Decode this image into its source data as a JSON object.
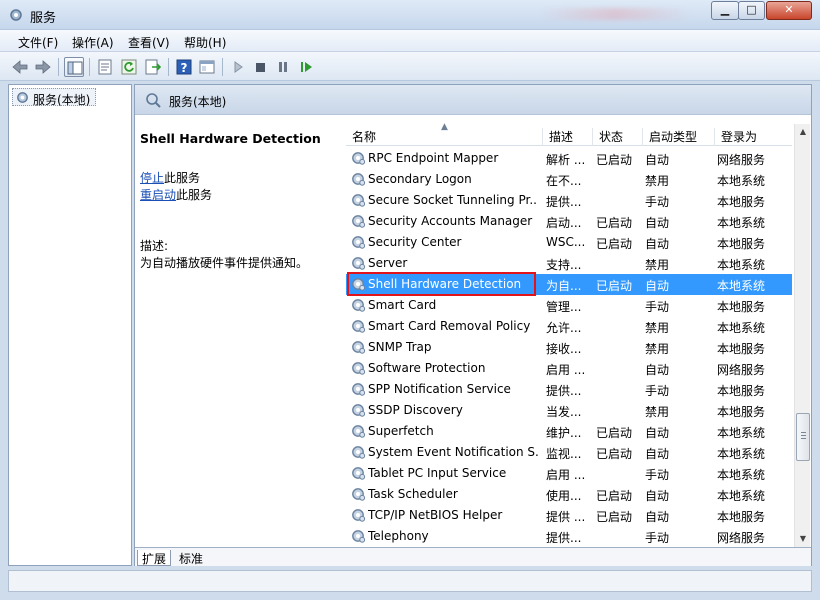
{
  "window": {
    "title": "服务"
  },
  "menu": [
    "文件(F)",
    "操作(A)",
    "查看(V)",
    "帮助(H)"
  ],
  "tree": {
    "root_label": "服务(本地)"
  },
  "content_header": {
    "title": "服务(本地)"
  },
  "details": {
    "service_name": "Shell Hardware Detection",
    "stop_link": "停止",
    "stop_suffix": "此服务",
    "restart_link": "重启动",
    "restart_suffix": "此服务",
    "desc_label": "描述:",
    "desc_text": "为自动播放硬件事件提供通知。"
  },
  "columns": {
    "name": "名称",
    "description": "描述",
    "status": "状态",
    "startup": "启动类型",
    "logon": "登录为"
  },
  "services": [
    {
      "name": "RPC Endpoint Mapper",
      "description": "解析 ...",
      "status": "已启动",
      "startup": "自动",
      "logon": "网络服务"
    },
    {
      "name": "Secondary Logon",
      "description": "在不...",
      "status": "",
      "startup": "禁用",
      "logon": "本地系统"
    },
    {
      "name": "Secure Socket Tunneling Pr...",
      "description": "提供...",
      "status": "",
      "startup": "手动",
      "logon": "本地服务"
    },
    {
      "name": "Security Accounts Manager",
      "description": "启动...",
      "status": "已启动",
      "startup": "自动",
      "logon": "本地系统"
    },
    {
      "name": "Security Center",
      "description": "WSC...",
      "status": "已启动",
      "startup": "自动",
      "logon": "本地服务"
    },
    {
      "name": "Server",
      "description": "支持...",
      "status": "",
      "startup": "禁用",
      "logon": "本地系统"
    },
    {
      "name": "Shell Hardware Detection",
      "description": "为自...",
      "status": "已启动",
      "startup": "自动",
      "logon": "本地系统",
      "selected": true
    },
    {
      "name": "Smart Card",
      "description": "管理...",
      "status": "",
      "startup": "手动",
      "logon": "本地服务"
    },
    {
      "name": "Smart Card Removal Policy",
      "description": "允许...",
      "status": "",
      "startup": "禁用",
      "logon": "本地系统"
    },
    {
      "name": "SNMP Trap",
      "description": "接收...",
      "status": "",
      "startup": "禁用",
      "logon": "本地服务"
    },
    {
      "name": "Software Protection",
      "description": "启用 ...",
      "status": "",
      "startup": "自动",
      "logon": "网络服务"
    },
    {
      "name": "SPP Notification Service",
      "description": "提供...",
      "status": "",
      "startup": "手动",
      "logon": "本地服务"
    },
    {
      "name": "SSDP Discovery",
      "description": "当发...",
      "status": "",
      "startup": "禁用",
      "logon": "本地服务"
    },
    {
      "name": "Superfetch",
      "description": "维护...",
      "status": "已启动",
      "startup": "自动",
      "logon": "本地系统"
    },
    {
      "name": "System Event Notification S...",
      "description": "监视...",
      "status": "已启动",
      "startup": "自动",
      "logon": "本地系统"
    },
    {
      "name": "Tablet PC Input Service",
      "description": "启用 ...",
      "status": "",
      "startup": "手动",
      "logon": "本地系统"
    },
    {
      "name": "Task Scheduler",
      "description": "使用...",
      "status": "已启动",
      "startup": "自动",
      "logon": "本地系统"
    },
    {
      "name": "TCP/IP NetBIOS Helper",
      "description": "提供 ...",
      "status": "已启动",
      "startup": "自动",
      "logon": "本地服务"
    },
    {
      "name": "Telephony",
      "description": "提供...",
      "status": "",
      "startup": "手动",
      "logon": "网络服务"
    }
  ],
  "tabs": [
    "扩展",
    "标准"
  ],
  "colors": {
    "selection": "#3399ff",
    "highlight_border": "#e0141a",
    "link": "#1a4fb5"
  },
  "toolbar_icons": [
    "back-arrow-icon",
    "forward-arrow-icon",
    "show-hide-tree-icon",
    "properties-icon",
    "refresh-icon",
    "export-list-icon",
    "help-icon",
    "view-icon",
    "start-service-icon",
    "stop-service-icon",
    "pause-service-icon",
    "resume-service-icon"
  ]
}
